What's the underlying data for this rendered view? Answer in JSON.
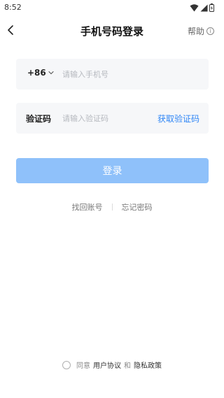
{
  "status_bar": {
    "time": "8:52",
    "icons": [
      "wifi-icon",
      "signal-icon",
      "battery-icon"
    ]
  },
  "nav": {
    "back_icon": "chevron-left-icon",
    "title": "手机号码登录",
    "help_label": "帮助",
    "help_icon": "info-circle-icon"
  },
  "phone_field": {
    "country_code": "+86",
    "country_icon": "chevron-down-icon",
    "value": "",
    "placeholder": "请输入手机号"
  },
  "code_field": {
    "label": "验证码",
    "value": "",
    "placeholder": "请输入验证码",
    "get_code_label": "获取验证码"
  },
  "login_button": {
    "label": "登录",
    "state": "disabled"
  },
  "links": {
    "recover_account": "找回账号",
    "forgot_password": "忘记密码"
  },
  "agreement": {
    "checked": false,
    "prefix": "同意",
    "user_agreement": "用户协议",
    "conjunction": "和",
    "privacy_policy": "隐私政策"
  },
  "colors": {
    "accent": "#2f86f6",
    "button_disabled": "#8fc1fa",
    "field_bg": "#f6f7f9",
    "placeholder": "#b6b9bf"
  }
}
